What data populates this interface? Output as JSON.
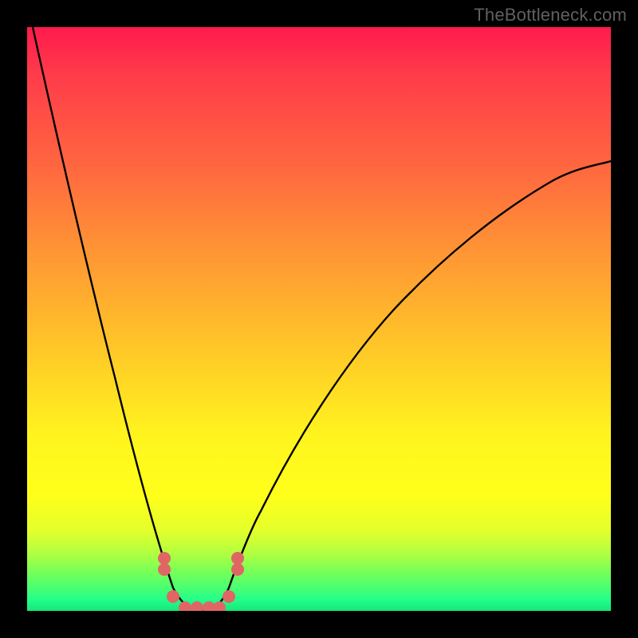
{
  "watermark": "TheBottleneck.com",
  "chart_data": {
    "type": "line",
    "title": "",
    "xlabel": "",
    "ylabel": "",
    "xlim": [
      0,
      100
    ],
    "ylim": [
      0,
      100
    ],
    "series": [
      {
        "name": "bottleneck-curve",
        "x": [
          1,
          5,
          10,
          15,
          20,
          23,
          26,
          28,
          30,
          32,
          34,
          36,
          40,
          50,
          60,
          70,
          80,
          90,
          100
        ],
        "values": [
          100,
          82,
          60,
          40,
          20,
          10,
          3,
          1,
          0,
          1,
          3,
          8,
          17,
          35,
          49,
          59,
          67,
          73,
          77
        ]
      }
    ],
    "markers": {
      "name": "highlight-dots",
      "x": [
        23.5,
        25,
        27,
        29,
        31,
        33,
        34.5
      ],
      "values": [
        9,
        2,
        0.5,
        0.5,
        0.5,
        2,
        9
      ]
    },
    "gradient_meaning": "red_top_high_bottleneck_green_bottom_low_bottleneck"
  }
}
